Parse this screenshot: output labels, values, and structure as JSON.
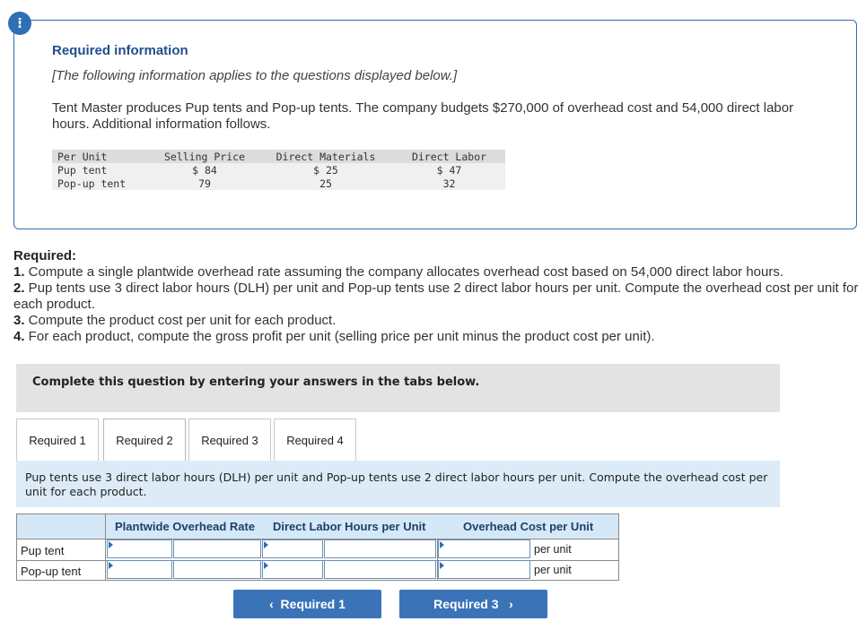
{
  "alert": {
    "icon_glyph": "!"
  },
  "info": {
    "title": "Required information",
    "note": "[The following information applies to the questions displayed below.]",
    "description": "Tent Master produces Pup tents and Pop-up tents. The company budgets $270,000 of overhead cost and 54,000 direct labor hours. Additional information follows.",
    "table": {
      "headers": [
        "Per Unit",
        "Selling Price",
        "Direct Materials",
        "Direct Labor"
      ],
      "rows": [
        [
          "Pup tent",
          "$ 84",
          "$ 25",
          "$ 47"
        ],
        [
          "Pop-up tent",
          "79",
          "25",
          "32"
        ]
      ]
    }
  },
  "required": {
    "heading": "Required:",
    "items": [
      {
        "num": "1.",
        "text": " Compute a single plantwide overhead rate assuming the company allocates overhead cost based on 54,000 direct labor hours."
      },
      {
        "num": "2.",
        "text": " Pup tents use 3 direct labor hours (DLH) per unit and Pop-up tents use 2 direct labor hours per unit. Compute the overhead cost per unit for each product."
      },
      {
        "num": "3.",
        "text": " Compute the product cost per unit for each product."
      },
      {
        "num": "4.",
        "text": " For each product, compute the gross profit per unit (selling price per unit minus the product cost per unit)."
      }
    ]
  },
  "complete_text": "Complete this question by entering your answers in the tabs below.",
  "tabs": [
    "Required 1",
    "Required 2",
    "Required 3",
    "Required 4"
  ],
  "active_tab": "Required 2",
  "instruction": "Pup tents use 3 direct labor hours (DLH) per unit and Pop-up tents use 2 direct labor hours per unit. Compute the overhead cost per unit for each product.",
  "answer_table": {
    "headers": [
      "Plantwide Overhead Rate",
      "Direct Labor Hours per Unit",
      "Overhead Cost per Unit"
    ],
    "rows": [
      {
        "label": "Pup tent",
        "suffix": "per unit"
      },
      {
        "label": "Pop-up tent",
        "suffix": "per unit"
      }
    ]
  },
  "nav": {
    "prev_label": "Required 1",
    "next_label": "Required 3",
    "prev_icon": "chevron-left-icon",
    "next_icon": "chevron-right-icon"
  },
  "colors": {
    "accent": "#2f6fb3",
    "button": "#3b73b9",
    "instruction_bg": "#dcebf7",
    "header_bg": "#d5e8f7"
  }
}
